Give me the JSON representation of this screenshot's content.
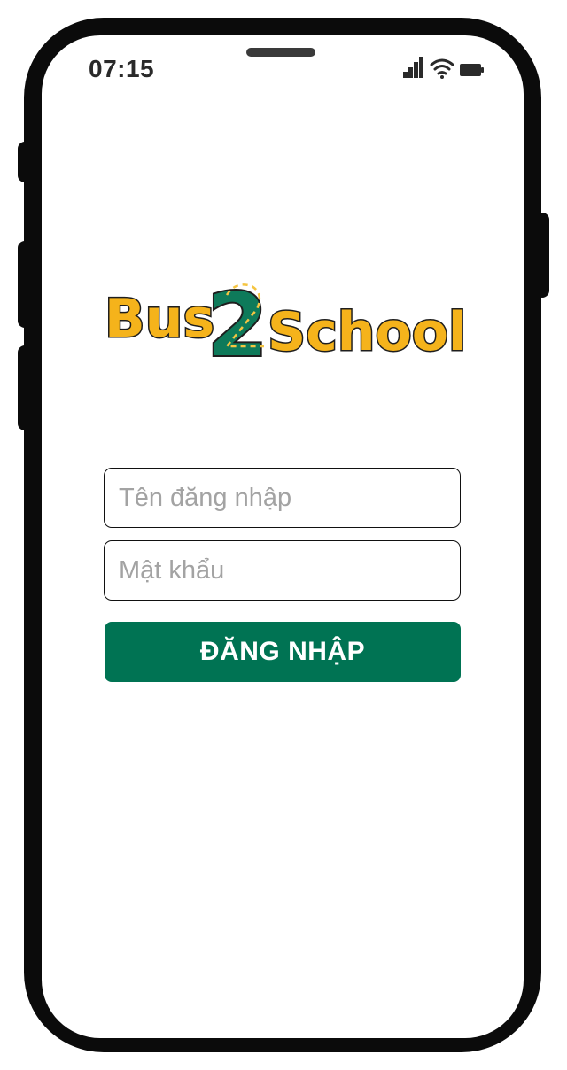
{
  "status_bar": {
    "time": "07:15",
    "icons": [
      "cellular-signal-icon",
      "wifi-icon",
      "battery-icon"
    ]
  },
  "logo": {
    "text_left": "Bus",
    "numeral": "2",
    "text_right": "School",
    "colors": {
      "text": "#F5B31B",
      "numeral": "#0E7A5A",
      "outline": "#1E1E1E",
      "road_dash": "#F5C542"
    }
  },
  "login_form": {
    "username_placeholder": "Tên đăng nhập",
    "username_value": "",
    "password_placeholder": "Mật khẩu",
    "password_value": "",
    "submit_label": "ĐĂNG NHẬP"
  },
  "colors": {
    "primary": "#007353",
    "phone_frame": "#0B0B0B"
  }
}
